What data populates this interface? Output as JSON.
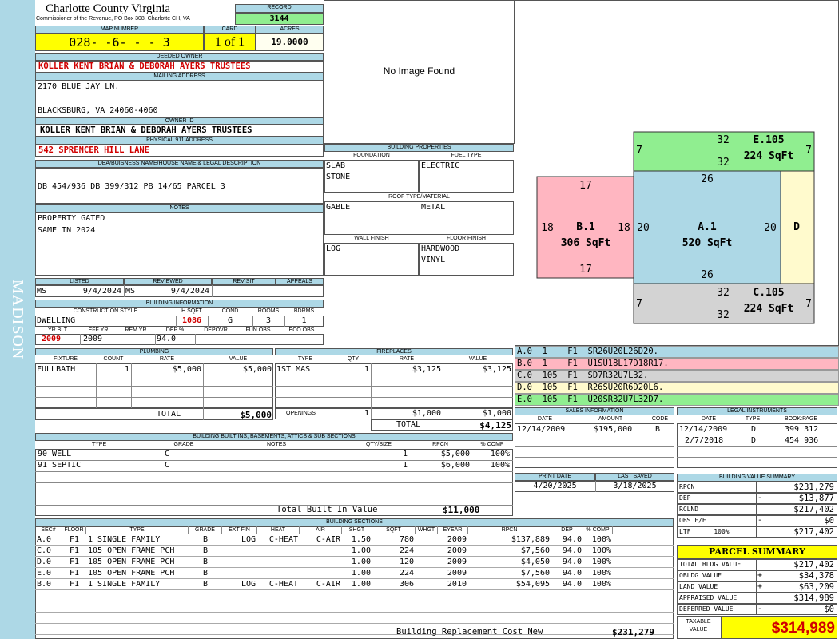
{
  "header": {
    "county": "Charlotte County Virginia",
    "commissioner": "Commissioner of the Revenue, PO Box 308, Charlotte CH, VA",
    "record_label": "RECORD",
    "record": "3144",
    "map_label": "MAP NUMBER",
    "map_number": "028- -6- - - 3",
    "card_label": "CARD",
    "card": "1 of 1",
    "acres_label": "ACRES",
    "acres": "19.0000",
    "side_label": "MADISON"
  },
  "owner": {
    "deeded_label": "DEEDED OWNER",
    "deeded": "KOLLER KENT BRIAN & DEBORAH AYERS TRUSTEES",
    "mailing_label": "MAILING ADDRESS",
    "mail1": "2170 BLUE JAY LN.",
    "mail2": "BLACKSBURG, VA 24060-4060",
    "id_label": "OWNER ID",
    "owner_id": "KOLLER KENT BRIAN & DEBORAH AYERS TRUSTEES",
    "physical_label": "PHYSICAL 911 ADDRESS",
    "physical": "542 SPRENCER HILL LANE",
    "dba_label": "DBA/BUISNESS NAME/HOUSE NAME & LEGAL DESCRIPTION",
    "legal": "DB 454/936 DB 399/312 PB 14/65 PARCEL 3",
    "notes_label": "NOTES",
    "note1": "PROPERTY GATED",
    "note2": "SAME IN 2024"
  },
  "image": {
    "text": "No Image Found"
  },
  "bprops": {
    "title": "BUILDING PROPERTIES",
    "foundation_label": "FOUNDATION",
    "fuel_label": "FUEL TYPE",
    "foundation1": "SLAB",
    "foundation2": "STONE",
    "fuel": "ELECTRIC",
    "roof_label": "ROOF TYPE/MATERIAL",
    "roof_type": "GABLE",
    "roof_mat": "METAL",
    "wall_label": "WALL FINISH",
    "floor_label": "FLOOR FINISH",
    "wall": "LOG",
    "floor1": "HARDWOOD",
    "floor2": "VINYL"
  },
  "listing": {
    "listed_label": "LISTED",
    "reviewed_label": "REVIEWED",
    "revisit_label": "REVISIT",
    "appeals_label": "APPEALS",
    "listed_by": "MS",
    "listed_date": "9/4/2024",
    "reviewed_by": "MS",
    "reviewed_date": "9/4/2024"
  },
  "binfo": {
    "title": "BUILDING INFORMATION",
    "h_style": "CONSTRUCTION STYLE",
    "h_hsqft": "H SQFT",
    "h_cond": "COND",
    "h_rooms": "ROOMS",
    "h_bdrms": "BDRMS",
    "style": "DWELLING",
    "hsqft": "1086",
    "cond": "G",
    "rooms": "3",
    "bdrms": "1",
    "h_yrblt": "YR BLT",
    "h_effyr": "EFF YR",
    "h_remyr": "REM YR",
    "h_dep": "DEP %",
    "h_depovr": "DEPOVR",
    "h_funobs": "FUN OBS",
    "h_ecoobs": "ECO OBS",
    "yrblt": "2009",
    "effyr": "2009",
    "dep": "94.0"
  },
  "plumbing": {
    "title": "PLUMBING",
    "h_fixture": "FIXTURE",
    "h_count": "COUNT",
    "h_rate": "RATE",
    "h_value": "VALUE",
    "fixture": "FULLBATH",
    "count": "1",
    "rate": "$5,000",
    "value": "$5,000",
    "total_label": "TOTAL",
    "total": "$5,000"
  },
  "fireplaces": {
    "title": "FIREPLACES",
    "h_type": "TYPE",
    "h_qty": "QTY",
    "h_rate": "RATE",
    "h_value": "VALUE",
    "type": "1ST MAS",
    "qty": "1",
    "rate": "$3,125",
    "value": "$3,125",
    "openings_label": "OPENINGS",
    "op_qty": "1",
    "op_rate": "$1,000",
    "op_value": "$1,000",
    "total_label": "TOTAL",
    "total": "$4,125"
  },
  "sketch": {
    "areas": [
      {
        "label": "B.1",
        "sqft": "306 SqFt"
      },
      {
        "label": "A.1",
        "sqft": "520 SqFt"
      },
      {
        "label": "E.105",
        "sqft": "224 SqFt"
      },
      {
        "label": "C.105",
        "sqft": "224 SqFt"
      },
      {
        "label": "D",
        "sqft": ""
      }
    ],
    "dims": {
      "e_top": "32",
      "e_bot": "32",
      "e_left": "7",
      "e_right": "7",
      "b_top": "17",
      "b_bot": "17",
      "b_left": "18",
      "b_right": "18",
      "a_top": "26",
      "a_bot": "26",
      "a_left": "20",
      "a_right": "20",
      "c_top": "32",
      "c_bot": "32",
      "c_left": "7",
      "c_right": "7"
    },
    "colors": {
      "a": "#add8e6",
      "b": "#ffb6c1",
      "c": "#d3d3d3",
      "d": "#fffacd",
      "e": "#90ee90"
    }
  },
  "legend": [
    {
      "text": "A.0  1    F1  SR26U20L26D20.",
      "color": "#add8e6"
    },
    {
      "text": "B.0  1    F1  U1SU18L17D18R17.",
      "color": "#ffb6c1"
    },
    {
      "text": "C.0  105  F1  SD7R32U7L32.",
      "color": "#d3d3d3"
    },
    {
      "text": "D.0  105  F1  R26SU20R6D20L6.",
      "color": "#fffacd"
    },
    {
      "text": "E.0  105  F1  U20SR32U7L32D7.",
      "color": "#90ee90"
    }
  ],
  "sales": {
    "title": "SALES INFORMATION",
    "h_date": "DATE",
    "h_amount": "AMOUNT",
    "h_code": "CODE",
    "date": "12/14/2009",
    "amount": "$195,000",
    "code": "B"
  },
  "legal_instr": {
    "title": "LEGAL INSTRUMENTS",
    "h_date": "DATE",
    "h_type": "TYPE",
    "h_book": "BOOK:PAGE",
    "rows": [
      {
        "date": "12/14/2009",
        "type": "D",
        "book": "399 312"
      },
      {
        "date": "2/7/2018",
        "type": "D",
        "book": "454 936"
      }
    ]
  },
  "print": {
    "print_label": "PRINT DATE",
    "saved_label": "LAST SAVED",
    "print_date": "4/20/2025",
    "saved_date": "3/18/2025"
  },
  "builtins": {
    "title": "BUILDING BUILT INS, BASEMENTS, ATTICS & SUB SECTIONS",
    "h_type": "TYPE",
    "h_grade": "GRADE",
    "h_notes": "NOTES",
    "h_qty": "QTY/SIZE",
    "h_rpcn": "RPCN",
    "h_comp": "% COMP",
    "rows": [
      {
        "type": "90 WELL",
        "grade": "C",
        "qty": "1",
        "rpcn": "$5,000",
        "comp": "100%"
      },
      {
        "type": "91 SEPTIC",
        "grade": "C",
        "qty": "1",
        "rpcn": "$6,000",
        "comp": "100%"
      }
    ],
    "total_label": "Total Built In Value",
    "total": "$11,000"
  },
  "sections": {
    "title": "BUILDING SECTIONS",
    "headers": [
      "SEC#",
      "FLOOR",
      "TYPE",
      "GRADE",
      "EXT FIN",
      "HEAT",
      "AIR",
      "SHGT",
      "SQFT",
      "WHGT",
      "EYEAR",
      "RPCN",
      "DEP",
      "% COMP"
    ],
    "rows": [
      {
        "sec": "A.0",
        "floor": "F1",
        "type": "1 SINGLE FAMILY",
        "grade": "B",
        "ext": "LOG",
        "heat": "C-HEAT",
        "air": "C-AIR",
        "shgt": "1.50",
        "sqft": "780",
        "eyear": "2009",
        "rpcn": "$137,889",
        "dep": "94.0",
        "comp": "100%"
      },
      {
        "sec": "C.0",
        "floor": "F1",
        "type": "105 OPEN FRAME PCH",
        "grade": "B",
        "ext": "",
        "heat": "",
        "air": "",
        "shgt": "1.00",
        "sqft": "224",
        "eyear": "2009",
        "rpcn": "$7,560",
        "dep": "94.0",
        "comp": "100%"
      },
      {
        "sec": "D.0",
        "floor": "F1",
        "type": "105 OPEN FRAME PCH",
        "grade": "B",
        "ext": "",
        "heat": "",
        "air": "",
        "shgt": "1.00",
        "sqft": "120",
        "eyear": "2009",
        "rpcn": "$4,050",
        "dep": "94.0",
        "comp": "100%"
      },
      {
        "sec": "E.0",
        "floor": "F1",
        "type": "105 OPEN FRAME PCH",
        "grade": "B",
        "ext": "",
        "heat": "",
        "air": "",
        "shgt": "1.00",
        "sqft": "224",
        "eyear": "2009",
        "rpcn": "$7,560",
        "dep": "94.0",
        "comp": "100%"
      },
      {
        "sec": "B.0",
        "floor": "F1",
        "type": "1 SINGLE FAMILY",
        "grade": "B",
        "ext": "LOG",
        "heat": "C-HEAT",
        "air": "C-AIR",
        "shgt": "1.00",
        "sqft": "306",
        "eyear": "2010",
        "rpcn": "$54,095",
        "dep": "94.0",
        "comp": "100%"
      }
    ],
    "rcn_label": "Building Replacement Cost New",
    "rcn": "$231,279"
  },
  "bvs": {
    "title": "BUILDING VALUE SUMMARY",
    "rows": [
      {
        "label": "RPCN",
        "sign": "",
        "value": "$231,279"
      },
      {
        "label": "DEP",
        "sign": "-",
        "value": "$13,877"
      },
      {
        "label": "RCLND",
        "sign": "",
        "value": "$217,402"
      },
      {
        "label": "OBS F/E",
        "sign": "-",
        "value": "$0"
      },
      {
        "label": "LTF      100%",
        "sign": "",
        "value": "$217,402"
      }
    ]
  },
  "parcel": {
    "title": "PARCEL SUMMARY",
    "rows": [
      {
        "label": "TOTAL BLDG VALUE",
        "sign": "",
        "value": "$217,402"
      },
      {
        "label": "OBLDG VALUE",
        "sign": "+",
        "value": "$34,378"
      },
      {
        "label": "LAND VALUE",
        "sign": "+",
        "value": "$63,209"
      },
      {
        "label": "APPRAISED VALUE",
        "sign": "",
        "value": "$314,989"
      },
      {
        "label": "DEFERRED VALUE",
        "sign": "-",
        "value": "$0"
      }
    ],
    "taxable_label": "TAXABLE VALUE",
    "taxable": "$314,989"
  }
}
